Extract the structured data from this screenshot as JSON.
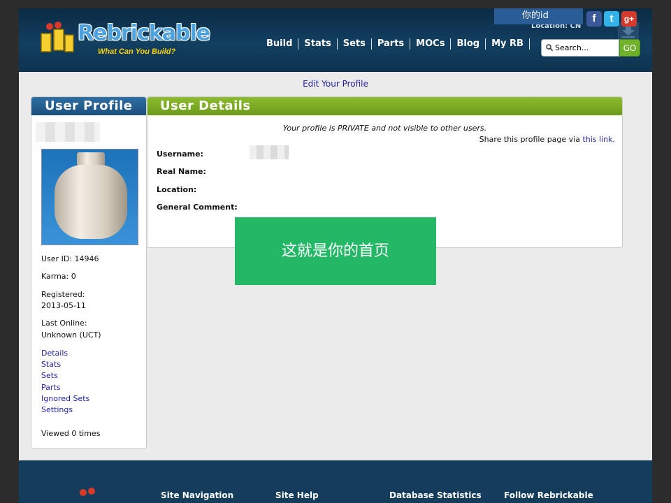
{
  "header": {
    "logo_text": "Rebrickable",
    "tagline": "What Can You Build?",
    "nav": [
      "Build",
      "Stats",
      "Sets",
      "Parts",
      "MOCs",
      "Blog",
      "My RB"
    ],
    "location": "Location: CN",
    "id_banner": "你的id",
    "social": {
      "facebook": "f",
      "twitter": "t",
      "google": "g+"
    },
    "search": {
      "placeholder": "Search...",
      "value": "Search...",
      "go": "GO"
    }
  },
  "edit_profile": "Edit Your Profile",
  "profile_panel": {
    "title": "User Profile",
    "user_id": "User ID: 14946",
    "karma": "Karma: 0",
    "registered_label": "Registered:",
    "registered_date": "2013-05-11",
    "last_online_label": "Last Online:",
    "last_online_value": "Unknown (UCT)",
    "links": [
      "Details",
      "Stats",
      "Sets",
      "Parts",
      "Ignored Sets",
      "Settings"
    ],
    "viewed": "Viewed 0 times"
  },
  "details_panel": {
    "title": "User Details",
    "private_note": "Your profile is PRIVATE and not visible to other users.",
    "share_prefix": "Share this profile page via ",
    "share_link": "this link",
    "share_suffix": ".",
    "labels": [
      "Username:",
      "Real Name:",
      "Location:",
      "General Comment:"
    ]
  },
  "callout": "这就是你的首页",
  "footer": {
    "headings": [
      "Site Navigation",
      "Site Help",
      "Database Statistics",
      "Follow Rebrickable"
    ]
  },
  "colors": {
    "header_bg": "#123f60",
    "profile_title_bg": "#1c4f7d",
    "details_title_bg": "#7aa924",
    "link": "#2222aa",
    "callout_bg": "#23b866",
    "search_go": "#6eb22c"
  }
}
